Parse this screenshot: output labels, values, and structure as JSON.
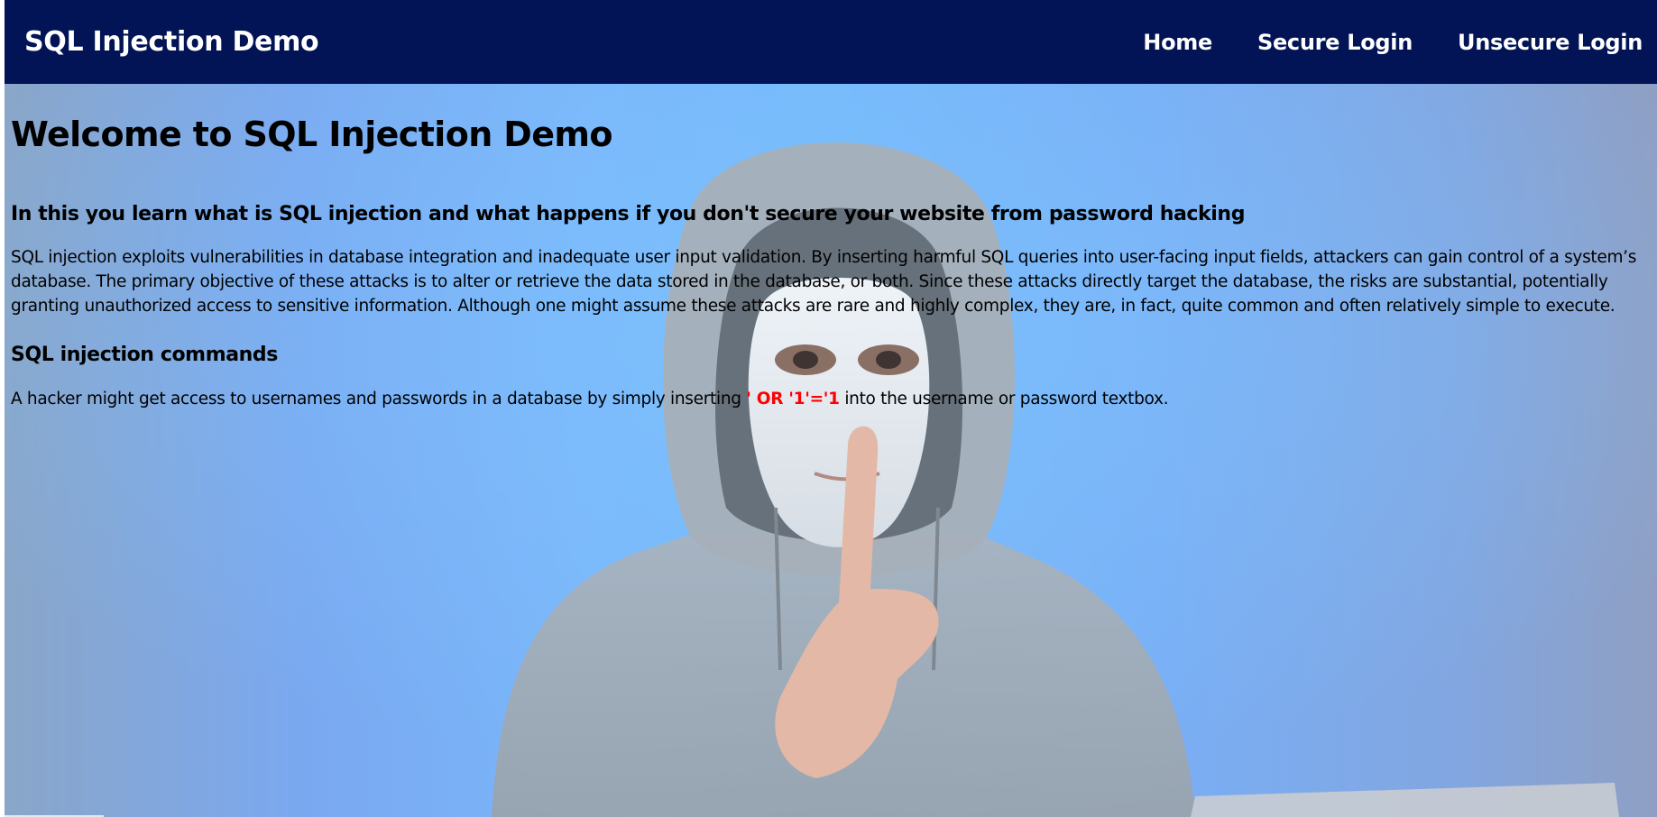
{
  "navbar": {
    "brand": "SQL Injection Demo",
    "links": [
      {
        "label": "Home"
      },
      {
        "label": "Secure Login"
      },
      {
        "label": "Unsecure Login"
      }
    ],
    "background_color": "#021455"
  },
  "main": {
    "title": "Welcome to SQL Injection Demo",
    "subtitle": "In this you learn what is SQL injection and what happens if you don't secure your website from password hacking",
    "description": "SQL injection exploits vulnerabilities in database integration and inadequate user input validation. By inserting harmful SQL queries into user-facing input fields, attackers can gain control of a system’s database. The primary objective of these attacks is to alter or retrieve the data stored in the database, or both. Since these attacks directly target the database, the risks are substantial, potentially granting unauthorized access to sensitive information. Although one might assume these attacks are rare and highly complex, they are, in fact, quite common and often relatively simple to execute.",
    "commands_heading": "SQL injection commands",
    "commands_text_before": "A hacker might get access to usernames and passwords in a database by simply inserting ",
    "commands_injection": "' OR '1'='1",
    "commands_text_after": " into the username or password textbox.",
    "injection_color": "#ff0000"
  }
}
